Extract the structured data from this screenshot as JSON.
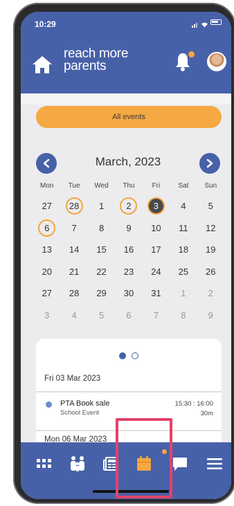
{
  "status_bar": {
    "time": "10:29"
  },
  "header": {
    "brand_line1": "reach more",
    "brand_line2": "parents"
  },
  "all_events_label": "All events",
  "calendar": {
    "title": "March, 2023",
    "weekdays": [
      "Mon",
      "Tue",
      "Wed",
      "Thu",
      "Fri",
      "Sat",
      "Sun"
    ],
    "weeks": [
      [
        {
          "d": "27",
          "muted": false,
          "style": ""
        },
        {
          "d": "28",
          "muted": false,
          "style": "ring"
        },
        {
          "d": "1",
          "muted": false,
          "style": ""
        },
        {
          "d": "2",
          "muted": false,
          "style": "ring"
        },
        {
          "d": "3",
          "muted": false,
          "style": "today"
        },
        {
          "d": "4",
          "muted": false,
          "style": ""
        },
        {
          "d": "5",
          "muted": false,
          "style": ""
        }
      ],
      [
        {
          "d": "6",
          "muted": false,
          "style": "ring"
        },
        {
          "d": "7",
          "muted": false,
          "style": ""
        },
        {
          "d": "8",
          "muted": false,
          "style": ""
        },
        {
          "d": "9",
          "muted": false,
          "style": ""
        },
        {
          "d": "10",
          "muted": false,
          "style": ""
        },
        {
          "d": "11",
          "muted": false,
          "style": ""
        },
        {
          "d": "12",
          "muted": false,
          "style": ""
        }
      ],
      [
        {
          "d": "13",
          "muted": false,
          "style": ""
        },
        {
          "d": "14",
          "muted": false,
          "style": ""
        },
        {
          "d": "15",
          "muted": false,
          "style": ""
        },
        {
          "d": "16",
          "muted": false,
          "style": ""
        },
        {
          "d": "17",
          "muted": false,
          "style": ""
        },
        {
          "d": "18",
          "muted": false,
          "style": ""
        },
        {
          "d": "19",
          "muted": false,
          "style": ""
        }
      ],
      [
        {
          "d": "20",
          "muted": false,
          "style": ""
        },
        {
          "d": "21",
          "muted": false,
          "style": ""
        },
        {
          "d": "22",
          "muted": false,
          "style": ""
        },
        {
          "d": "23",
          "muted": false,
          "style": ""
        },
        {
          "d": "24",
          "muted": false,
          "style": ""
        },
        {
          "d": "25",
          "muted": false,
          "style": ""
        },
        {
          "d": "26",
          "muted": false,
          "style": ""
        }
      ],
      [
        {
          "d": "27",
          "muted": false,
          "style": ""
        },
        {
          "d": "28",
          "muted": false,
          "style": ""
        },
        {
          "d": "29",
          "muted": false,
          "style": ""
        },
        {
          "d": "30",
          "muted": false,
          "style": ""
        },
        {
          "d": "31",
          "muted": false,
          "style": ""
        },
        {
          "d": "1",
          "muted": true,
          "style": ""
        },
        {
          "d": "2",
          "muted": true,
          "style": ""
        }
      ],
      [
        {
          "d": "3",
          "muted": true,
          "style": ""
        },
        {
          "d": "4",
          "muted": true,
          "style": ""
        },
        {
          "d": "5",
          "muted": true,
          "style": ""
        },
        {
          "d": "6",
          "muted": true,
          "style": ""
        },
        {
          "d": "7",
          "muted": true,
          "style": ""
        },
        {
          "d": "8",
          "muted": true,
          "style": ""
        },
        {
          "d": "9",
          "muted": true,
          "style": ""
        }
      ]
    ]
  },
  "events_panel": {
    "day1_heading": "Fri 03 Mar 2023",
    "event": {
      "title": "PTA Book sale",
      "category": "School Event",
      "time": "15:30 : 16:00",
      "duration": "30m"
    },
    "day2_heading": "Mon 06 Mar 2023"
  },
  "bottom_nav": {
    "items": [
      "apps-grid-icon",
      "family-icon",
      "newspaper-icon",
      "calendar-icon",
      "chat-icon",
      "menu-icon"
    ],
    "active": "calendar-icon"
  },
  "colors": {
    "brand_blue": "#4761a8",
    "accent_orange": "#f6a942",
    "highlight_pink": "#e2436a"
  }
}
